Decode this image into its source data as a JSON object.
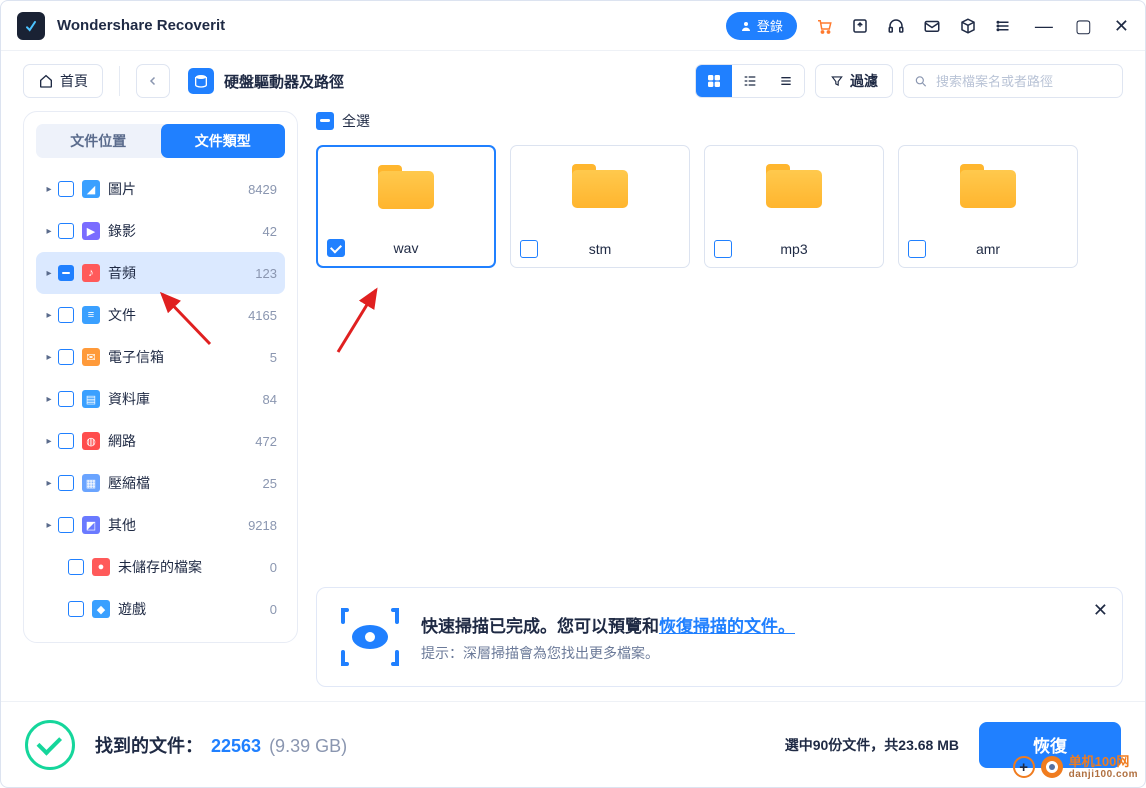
{
  "app_title": "Wondershare Recoverit",
  "login_label": "登錄",
  "toolbar": {
    "home_label": "首頁",
    "breadcrumb": "硬盤驅動器及路徑",
    "filter_label": "過濾",
    "search_placeholder": "搜索檔案名或者路徑"
  },
  "sidebar": {
    "tabs": {
      "location": "文件位置",
      "type": "文件類型"
    },
    "categories": [
      {
        "label": "圖片",
        "count": "8429",
        "icon_bg": "#3aa0ff",
        "icon_glyph": "◢"
      },
      {
        "label": "錄影",
        "count": "42",
        "icon_bg": "#7a6cff",
        "icon_glyph": "▶"
      },
      {
        "label": "音頻",
        "count": "123",
        "icon_bg": "#ff5a5a",
        "icon_glyph": "♪",
        "selected": true,
        "checked": true
      },
      {
        "label": "文件",
        "count": "4165",
        "icon_bg": "#3aa0ff",
        "icon_glyph": "≡"
      },
      {
        "label": "電子信箱",
        "count": "5",
        "icon_bg": "#ff9a3a",
        "icon_glyph": "✉"
      },
      {
        "label": "資料庫",
        "count": "84",
        "icon_bg": "#3aa0ff",
        "icon_glyph": "▤"
      },
      {
        "label": "網路",
        "count": "472",
        "icon_bg": "#ff4d4d",
        "icon_glyph": "◍"
      },
      {
        "label": "壓縮檔",
        "count": "25",
        "icon_bg": "#6aa4ff",
        "icon_glyph": "▦"
      },
      {
        "label": "其他",
        "count": "9218",
        "icon_bg": "#6a7aff",
        "icon_glyph": "◩"
      },
      {
        "label": "未儲存的檔案",
        "count": "0",
        "icon_bg": "#ff5a5a",
        "icon_glyph": "●",
        "sub": true
      },
      {
        "label": "遊戲",
        "count": "0",
        "icon_bg": "#3aa0ff",
        "icon_glyph": "◆",
        "sub": true
      }
    ]
  },
  "select_all_label": "全選",
  "folders": [
    {
      "name": "wav",
      "selected": true
    },
    {
      "name": "stm"
    },
    {
      "name": "mp3"
    },
    {
      "name": "amr"
    }
  ],
  "notice": {
    "title_prefix": "快速掃描已完成。您可以預覽和",
    "title_link": "恢復掃描的文件。",
    "subtitle": "提示：深層掃描會為您找出更多檔案。"
  },
  "footer": {
    "found_label": "找到的文件：",
    "found_count": "22563",
    "found_size": "(9.39 GB)",
    "selected_info": "選中90份文件，共23.68 MB",
    "recover_label": "恢復"
  },
  "watermark": {
    "line1": "单机100网",
    "line2": "danji100.com"
  }
}
